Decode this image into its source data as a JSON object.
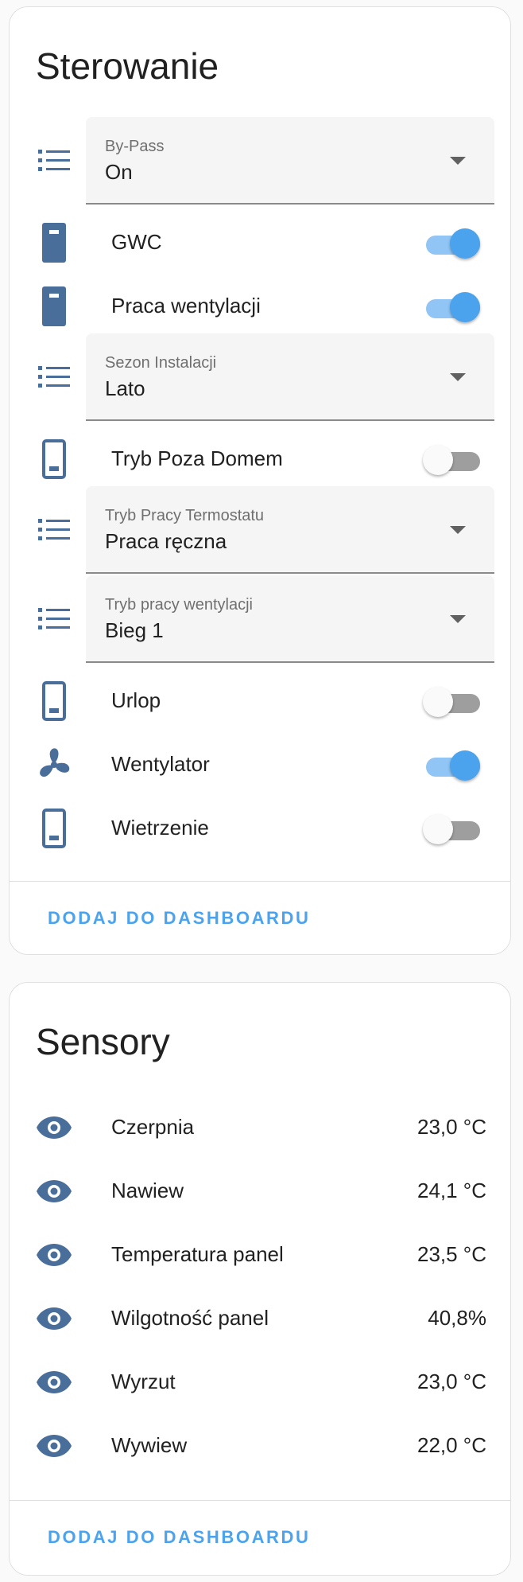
{
  "colors": {
    "accent": "#4ba3ee",
    "icon": "#4a6e9a"
  },
  "controls": {
    "title": "Sterowanie",
    "items": [
      {
        "type": "select",
        "label": "By-Pass",
        "value": "On",
        "icon": "list-icon"
      },
      {
        "type": "toggle",
        "label": "GWC",
        "state": "on",
        "icon": "device-icon"
      },
      {
        "type": "toggle",
        "label": "Praca wentylacji",
        "state": "on",
        "icon": "device-icon"
      },
      {
        "type": "select",
        "label": "Sezon Instalacji",
        "value": "Lato",
        "icon": "list-icon"
      },
      {
        "type": "toggle",
        "label": "Tryb Poza Domem",
        "state": "off",
        "icon": "device-off-icon"
      },
      {
        "type": "select",
        "label": "Tryb Pracy Termostatu",
        "value": "Praca ręczna",
        "icon": "list-icon"
      },
      {
        "type": "select",
        "label": "Tryb pracy wentylacji",
        "value": "Bieg 1",
        "icon": "list-icon"
      },
      {
        "type": "toggle",
        "label": "Urlop",
        "state": "off",
        "icon": "device-off-icon"
      },
      {
        "type": "toggle",
        "label": "Wentylator",
        "state": "on",
        "icon": "fan-icon"
      },
      {
        "type": "toggle",
        "label": "Wietrzenie",
        "state": "off",
        "icon": "device-off-icon"
      }
    ],
    "action": "DODAJ DO DASHBOARDU"
  },
  "sensors": {
    "title": "Sensory",
    "items": [
      {
        "label": "Czerpnia",
        "value": "23,0 °C",
        "icon": "eye-icon"
      },
      {
        "label": "Nawiew",
        "value": "24,1 °C",
        "icon": "eye-icon"
      },
      {
        "label": "Temperatura panel",
        "value": "23,5 °C",
        "icon": "eye-icon"
      },
      {
        "label": "Wilgotność panel",
        "value": "40,8%",
        "icon": "eye-icon"
      },
      {
        "label": "Wyrzut",
        "value": "23,0 °C",
        "icon": "eye-icon"
      },
      {
        "label": "Wywiew",
        "value": "22,0 °C",
        "icon": "eye-icon"
      }
    ],
    "action": "DODAJ DO DASHBOARDU"
  }
}
